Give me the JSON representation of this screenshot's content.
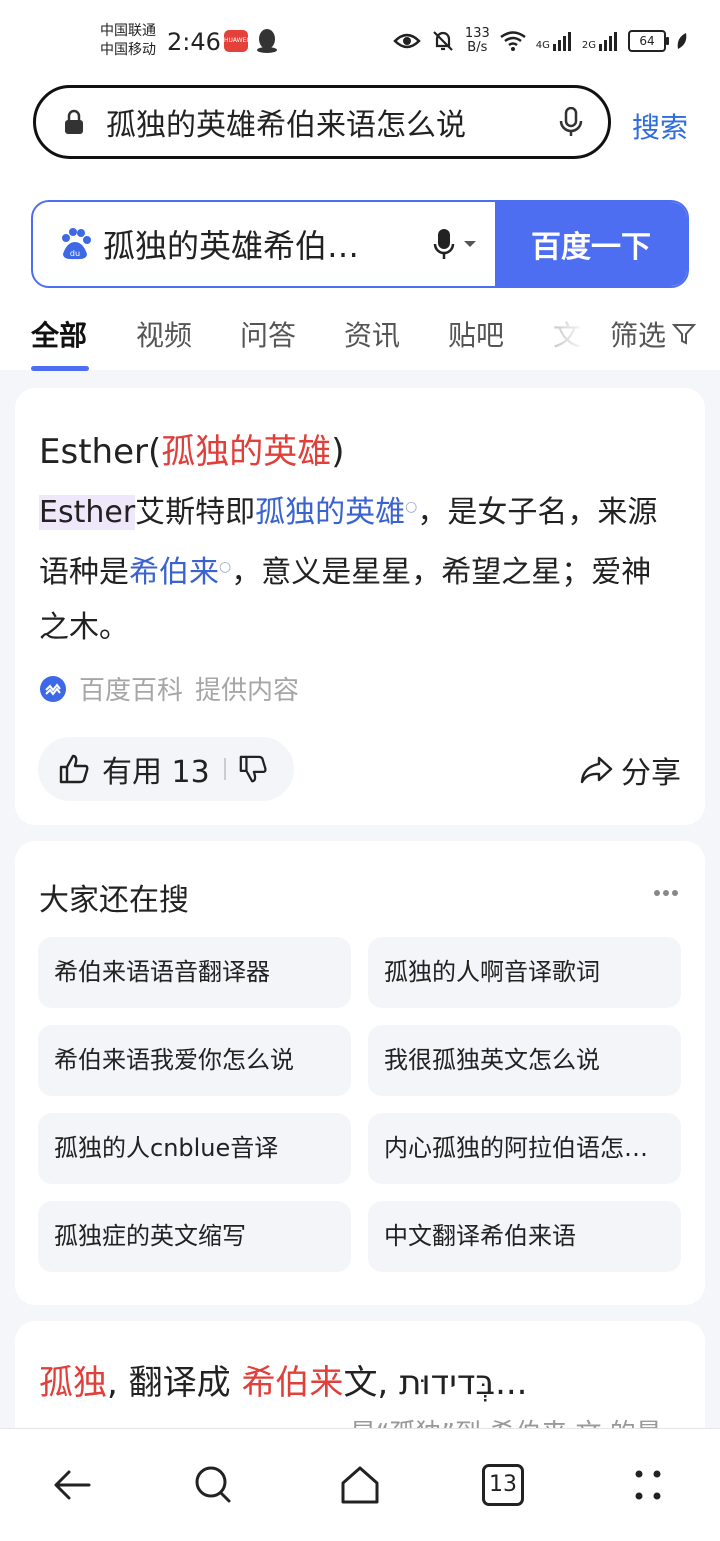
{
  "status_bar": {
    "carrier1": "中国联通",
    "carrier2": "中国移动",
    "time": "2:46",
    "app_badge": "HUAWEI",
    "net_speed_value": "133",
    "net_speed_unit": "B/s",
    "sig1": "4G",
    "sig2": "2G",
    "battery": "64"
  },
  "browser": {
    "query": "孤独的英雄希伯来语怎么说",
    "search_label": "搜索"
  },
  "baidu": {
    "query_short": "孤独的英雄希伯…",
    "button": "百度一下"
  },
  "tabs": [
    "全部",
    "视频",
    "问答",
    "资讯",
    "贴吧",
    "文"
  ],
  "filter_label": "筛选",
  "card1": {
    "title_prefix": "Esther(",
    "title_red": "孤独的英雄",
    "title_suffix": ")",
    "body": {
      "p1": "Esther",
      "p2": "艾斯特即",
      "p3": "孤独的英雄",
      "p4": "，是女子名，来源语种是",
      "p5": "希伯来",
      "p6": "，意义是星星，希望之星；爱神之木。"
    },
    "source_name": "百度百科",
    "source_suffix": "提供内容",
    "useful_label": "有用 13",
    "share_label": "分享"
  },
  "card2": {
    "title": "大家还在搜",
    "items": [
      "希伯来语语音翻译器",
      "孤独的人啊音译歌词",
      "希伯来语我爱你怎么说",
      "我很孤独英文怎么说",
      "孤独的人cnblue音译",
      "内心孤独的阿拉伯语怎…",
      "孤独症的英文缩写",
      "中文翻译希伯来语"
    ]
  },
  "card3": {
    "t1": "孤独",
    "t2": ", 翻译成 ",
    "t3": "希伯来",
    "t4": "文, בְּדידוּת...",
    "sub": "是“孤独”到 希伯来 文 的最"
  },
  "bottom_nav": {
    "tabs_count": "13"
  }
}
